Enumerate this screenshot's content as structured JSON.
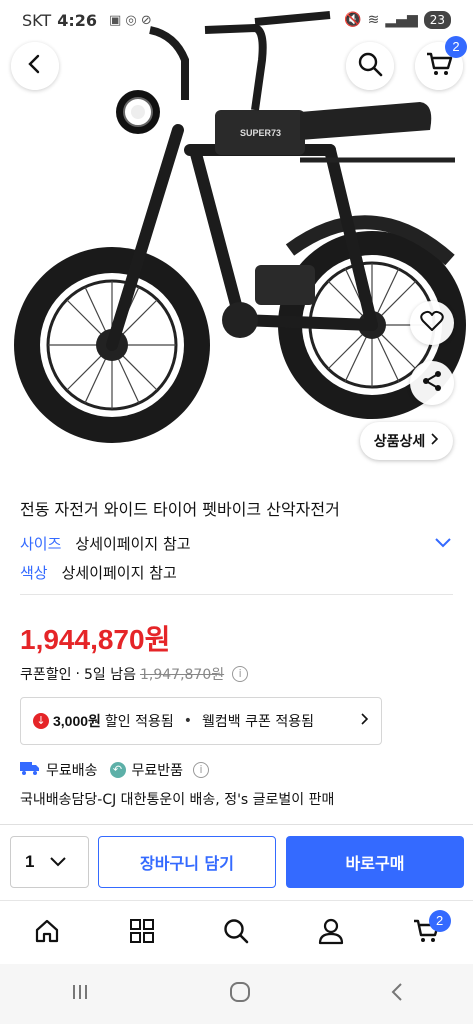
{
  "status_bar": {
    "carrier": "SKT",
    "time": "4:26",
    "battery": "23"
  },
  "header": {
    "cart_count": "2"
  },
  "product": {
    "detail_chip_label": "상품상세",
    "title": "전동 자전거 와이드 타이어 펫바이크 산악자전거",
    "options": [
      {
        "key": "사이즈",
        "value": "상세이페이지 참고"
      },
      {
        "key": "색상",
        "value": "상세이페이지 참고"
      }
    ],
    "price": "1,944,870원",
    "discount": {
      "label": "쿠폰할인",
      "sep": "·",
      "remaining": "5일 남음",
      "original_price": "1,947,870원"
    },
    "coupon": {
      "amount": "3,000원",
      "applied_text": "할인 적용됨",
      "bullet": "•",
      "welcome_text": "웰컴백 쿠폰 적용됨"
    },
    "shipping": {
      "free_shipping": "무료배송",
      "free_return": "무료반품"
    },
    "seller_text": "국내배송담당-CJ 대한통운이 배송, 정's 글로벌이 판매"
  },
  "purchase_bar": {
    "quantity": "1",
    "cart_button": "장바구니 담기",
    "buy_button": "바로구매"
  },
  "tab_bar": {
    "cart_count": "2"
  },
  "colors": {
    "accent": "#346aff",
    "price_red": "#e52528"
  }
}
